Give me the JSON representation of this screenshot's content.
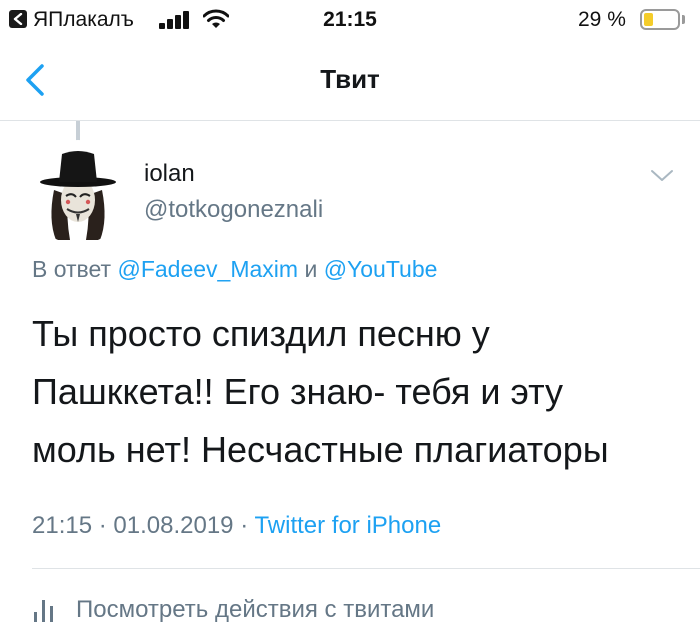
{
  "status_bar": {
    "back_app_label": "ЯПлакалъ",
    "time": "21:15",
    "battery_percent_label": "29 %",
    "battery_level": 0.29,
    "icons": [
      "back-to-app-icon",
      "cellular-signal-icon",
      "wifi-icon",
      "battery-icon"
    ]
  },
  "nav": {
    "title": "Твит",
    "back_icon": "chevron-left-icon"
  },
  "tweet": {
    "display_name": "iolan",
    "handle": "@totkogoneznali",
    "reply_prefix": "В ответ",
    "reply_mentions": [
      "@Fadeev_Maxim",
      "@YouTube"
    ],
    "reply_joiner": "и",
    "text_lines": [
      "Ты просто спиздил песню у",
      "Пашккета!! Его знаю- тебя и эту",
      "моль нет! Несчастные плагиаторы"
    ],
    "time": "21:15",
    "date": "01.08.2019",
    "separator": "·",
    "source": "Twitter for iPhone",
    "more_icon": "chevron-down-icon"
  },
  "actions": {
    "view_activity_label": "Посмотреть действия с твитами",
    "view_activity_icon": "bar-chart-icon"
  },
  "colors": {
    "link_blue": "#1da1f2",
    "secondary_gray": "#657786",
    "text_dark": "#14171a",
    "battery_yellow": "#f4cc2a"
  }
}
